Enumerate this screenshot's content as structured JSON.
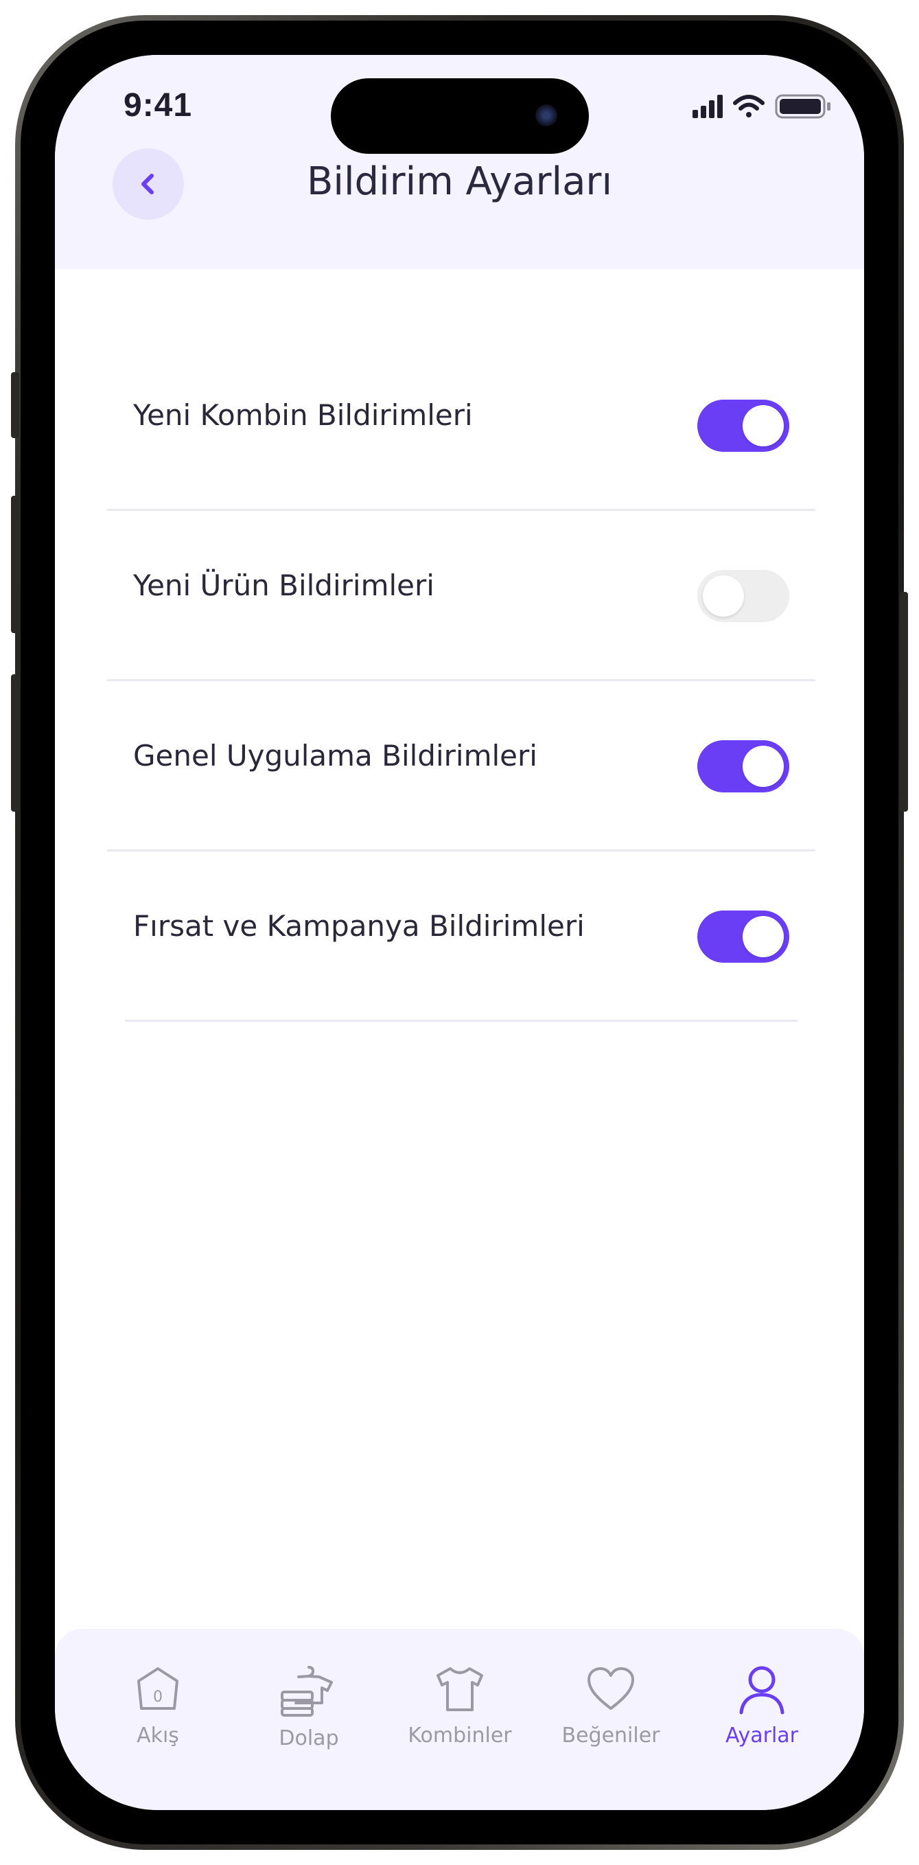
{
  "status_bar": {
    "time": "9:41"
  },
  "header": {
    "title": "Bildirim Ayarları"
  },
  "settings": [
    {
      "label": "Yeni Kombin Bildirimleri",
      "enabled": true
    },
    {
      "label": "Yeni Ürün Bildirimleri",
      "enabled": false
    },
    {
      "label": "Genel Uygulama Bildirimleri",
      "enabled": true
    },
    {
      "label": "Fırsat ve Kampanya Bildirimleri",
      "enabled": true
    }
  ],
  "tabbar": {
    "items": [
      {
        "label": "Akış",
        "icon": "home-icon",
        "badge": "0"
      },
      {
        "label": "Dolap",
        "icon": "wardrobe-icon"
      },
      {
        "label": "Kombinler",
        "icon": "tshirt-icon"
      },
      {
        "label": "Beğeniler",
        "icon": "heart-icon"
      },
      {
        "label": "Ayarlar",
        "icon": "user-icon",
        "active": true
      }
    ]
  },
  "colors": {
    "accent": "#6a3ef5",
    "header_bg": "#f5f3ff",
    "toggle_off": "#eeeeef",
    "text": "#2a2838",
    "inactive_tab": "#9b99a6"
  }
}
